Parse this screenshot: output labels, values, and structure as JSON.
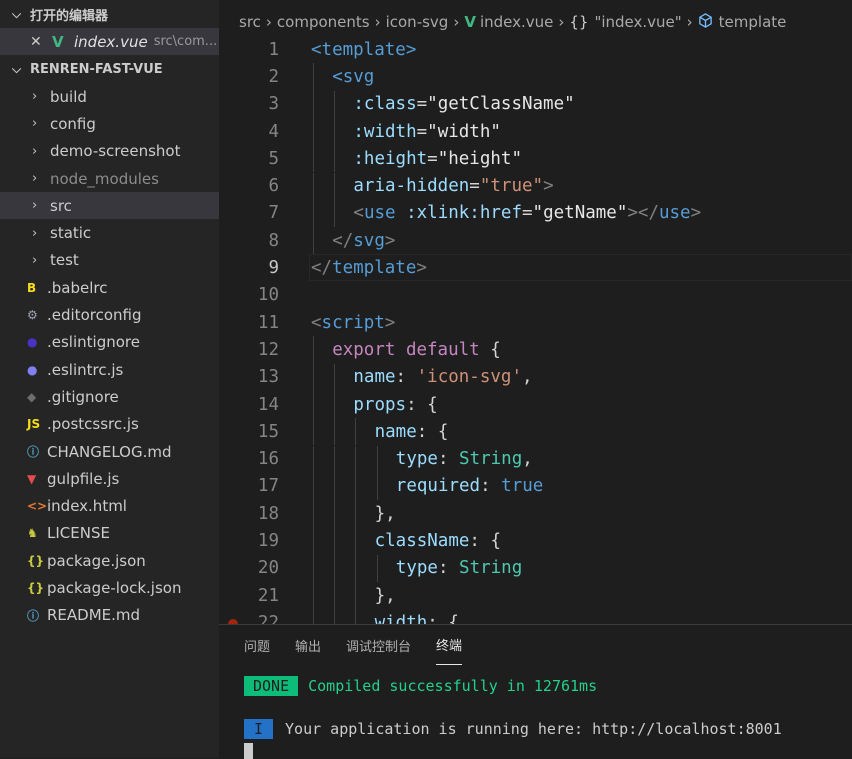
{
  "sidebar": {
    "open_editors_title": "打开的编辑器",
    "open_editor": {
      "close": "✕",
      "icon": "V",
      "name": "index.vue",
      "path": "src\\com..."
    },
    "project_title": "RENREN-FAST-VUE",
    "items": [
      {
        "label": "build",
        "kind": "folder",
        "icon": "›"
      },
      {
        "label": "config",
        "kind": "folder",
        "icon": "›"
      },
      {
        "label": "demo-screenshot",
        "kind": "folder",
        "icon": "›"
      },
      {
        "label": "node_modules",
        "kind": "folder",
        "icon": "›",
        "dim": true
      },
      {
        "label": "src",
        "kind": "folder",
        "icon": "›",
        "selected": true
      },
      {
        "label": "static",
        "kind": "folder",
        "icon": "›"
      },
      {
        "label": "test",
        "kind": "folder",
        "icon": "›"
      },
      {
        "label": ".babelrc",
        "kind": "file",
        "icon": "B",
        "color": "#f5de19",
        "iconName": "babel-icon"
      },
      {
        "label": ".editorconfig",
        "kind": "file",
        "icon": "⚙",
        "color": "#9da5b4",
        "iconName": "gear-icon"
      },
      {
        "label": ".eslintignore",
        "kind": "file",
        "icon": "●",
        "color": "#4b32c3",
        "iconName": "eslint-icon"
      },
      {
        "label": ".eslintrc.js",
        "kind": "file",
        "icon": "●",
        "color": "#8080f2",
        "iconName": "eslint-icon"
      },
      {
        "label": ".gitignore",
        "kind": "file",
        "icon": "◆",
        "color": "#6d6d6d",
        "iconName": "git-icon"
      },
      {
        "label": ".postcssrc.js",
        "kind": "file",
        "icon": "JS",
        "color": "#f5de19",
        "iconName": "js-icon"
      },
      {
        "label": "CHANGELOG.md",
        "kind": "file",
        "icon": "ⓘ",
        "color": "#519aba",
        "iconName": "info-icon"
      },
      {
        "label": "gulpfile.js",
        "kind": "file",
        "icon": "▼",
        "color": "#e44d4d",
        "iconName": "gulp-icon"
      },
      {
        "label": "index.html",
        "kind": "file",
        "icon": "<>",
        "color": "#e37933",
        "iconName": "html-icon"
      },
      {
        "label": "LICENSE",
        "kind": "file",
        "icon": "♞",
        "color": "#cbcb41",
        "iconName": "license-icon"
      },
      {
        "label": "package.json",
        "kind": "file",
        "icon": "{}",
        "color": "#cbcb41",
        "iconName": "json-icon"
      },
      {
        "label": "package-lock.json",
        "kind": "file",
        "icon": "{}",
        "color": "#cbcb41",
        "iconName": "json-icon"
      },
      {
        "label": "README.md",
        "kind": "file",
        "icon": "ⓘ",
        "color": "#519aba",
        "iconName": "info-icon"
      }
    ]
  },
  "breadcrumb": {
    "parts": [
      "src",
      "components",
      "icon-svg"
    ],
    "file": "index.vue",
    "symbol": "\"index.vue\"",
    "template": "template",
    "sep": "›",
    "brace": "{}"
  },
  "code": {
    "lines": [
      {
        "n": "1",
        "indent": 0,
        "tokens": [
          [
            "tag",
            "<template"
          ],
          [
            "tag",
            ">"
          ]
        ]
      },
      {
        "n": "2",
        "indent": 1,
        "tokens": [
          [
            "tag",
            "<svg"
          ]
        ]
      },
      {
        "n": "3",
        "indent": 2,
        "tokens": [
          [
            "attr",
            ":class"
          ],
          [
            "plain",
            "="
          ],
          [
            "strw",
            "\"getClassName\""
          ]
        ]
      },
      {
        "n": "4",
        "indent": 2,
        "tokens": [
          [
            "attr",
            ":width"
          ],
          [
            "plain",
            "="
          ],
          [
            "strw",
            "\"width\""
          ]
        ]
      },
      {
        "n": "5",
        "indent": 2,
        "tokens": [
          [
            "attr",
            ":height"
          ],
          [
            "plain",
            "="
          ],
          [
            "strw",
            "\"height\""
          ]
        ]
      },
      {
        "n": "6",
        "indent": 2,
        "tokens": [
          [
            "attr",
            "aria-hidden"
          ],
          [
            "plain",
            "="
          ],
          [
            "str",
            "\"true\""
          ],
          [
            "punc",
            ">"
          ]
        ]
      },
      {
        "n": "7",
        "indent": 2,
        "tokens": [
          [
            "punc",
            "<"
          ],
          [
            "tag",
            "use "
          ],
          [
            "attr",
            ":xlink:href"
          ],
          [
            "plain",
            "="
          ],
          [
            "strw",
            "\"getName\""
          ],
          [
            "punc",
            "></"
          ],
          [
            "tag",
            "use"
          ],
          [
            "punc",
            ">"
          ]
        ]
      },
      {
        "n": "8",
        "indent": 1,
        "tokens": [
          [
            "punc",
            "</"
          ],
          [
            "tag",
            "svg"
          ],
          [
            "punc",
            ">"
          ]
        ]
      },
      {
        "n": "9",
        "indent": 0,
        "tokens": [
          [
            "punc",
            "</"
          ],
          [
            "tag",
            "template"
          ],
          [
            "punc",
            ">"
          ]
        ],
        "highlight": true
      },
      {
        "n": "10",
        "indent": 0,
        "tokens": []
      },
      {
        "n": "11",
        "indent": 0,
        "tokens": [
          [
            "punc",
            "<"
          ],
          [
            "tag",
            "script"
          ],
          [
            "punc",
            ">"
          ]
        ]
      },
      {
        "n": "12",
        "indent": 1,
        "tokens": [
          [
            "kw",
            "export "
          ],
          [
            "kw",
            "default "
          ],
          [
            "plain",
            "{"
          ]
        ]
      },
      {
        "n": "13",
        "indent": 2,
        "tokens": [
          [
            "prop",
            "name"
          ],
          [
            "plain",
            ": "
          ],
          [
            "str",
            "'icon-svg'"
          ],
          [
            "plain",
            ","
          ]
        ]
      },
      {
        "n": "14",
        "indent": 2,
        "tokens": [
          [
            "prop",
            "props"
          ],
          [
            "plain",
            ": {"
          ]
        ]
      },
      {
        "n": "15",
        "indent": 3,
        "tokens": [
          [
            "prop",
            "name"
          ],
          [
            "plain",
            ": {"
          ]
        ]
      },
      {
        "n": "16",
        "indent": 4,
        "tokens": [
          [
            "prop",
            "type"
          ],
          [
            "plain",
            ": "
          ],
          [
            "type",
            "String"
          ],
          [
            "plain",
            ","
          ]
        ]
      },
      {
        "n": "17",
        "indent": 4,
        "tokens": [
          [
            "prop",
            "required"
          ],
          [
            "plain",
            ": "
          ],
          [
            "bool",
            "true"
          ]
        ]
      },
      {
        "n": "18",
        "indent": 3,
        "tokens": [
          [
            "plain",
            "},"
          ]
        ]
      },
      {
        "n": "19",
        "indent": 3,
        "tokens": [
          [
            "prop",
            "className"
          ],
          [
            "plain",
            ": {"
          ]
        ]
      },
      {
        "n": "20",
        "indent": 4,
        "tokens": [
          [
            "prop",
            "type"
          ],
          [
            "plain",
            ": "
          ],
          [
            "type",
            "String"
          ]
        ]
      },
      {
        "n": "21",
        "indent": 3,
        "tokens": [
          [
            "plain",
            "},"
          ]
        ]
      },
      {
        "n": "22",
        "indent": 3,
        "tokens": [
          [
            "prop",
            "width"
          ],
          [
            "plain",
            ": {"
          ]
        ],
        "breakpoint": true
      }
    ]
  },
  "panel": {
    "tabs": [
      {
        "label": "问题",
        "active": false
      },
      {
        "label": "输出",
        "active": false
      },
      {
        "label": "调试控制台",
        "active": false
      },
      {
        "label": "终端",
        "active": true
      }
    ],
    "done_badge": "DONE",
    "compiled": "Compiled successfully in 12761ms",
    "info_badge": "I",
    "running": "Your application is running here: http://localhost:8001"
  }
}
